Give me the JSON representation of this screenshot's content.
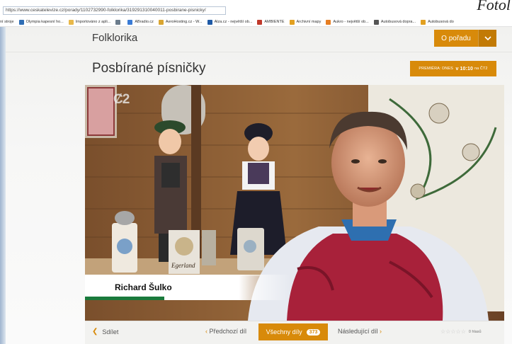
{
  "corner_text": "Fotol",
  "browser": {
    "url": "https://www.ceskatelevize.cz/porady/1102732990-folklorika/319291310040011-posbirane-pisnicky/",
    "bookmarks": [
      {
        "label": "ní stroje",
        "icon": "none",
        "color": "#ffffff"
      },
      {
        "label": "Olympia kapesní ho...",
        "icon": "doc-icon",
        "color": "#2e6db4"
      },
      {
        "label": "Importováno z apli...",
        "icon": "folder-icon",
        "color": "#e8b84a"
      },
      {
        "label": "",
        "icon": "puzzle-icon",
        "color": "#6b7c8c"
      },
      {
        "label": "ABradio.cz",
        "icon": "radio-icon",
        "color": "#3a7bd5"
      },
      {
        "label": "AeroHosting.cz - W...",
        "icon": "cloud-icon",
        "color": "#d9a531"
      },
      {
        "label": "Alza.cz - největší ob...",
        "icon": "cart-icon",
        "color": "#1f5aa6"
      },
      {
        "label": "AMBIENTE",
        "icon": "circle-icon",
        "color": "#c0392b"
      },
      {
        "label": "Archivní mapy",
        "icon": "map-icon",
        "color": "#e2a020"
      },
      {
        "label": "Aukro - největší ob...",
        "icon": "a-icon",
        "color": "#e67e22"
      },
      {
        "label": "Autobusová dopra...",
        "icon": "bus-icon",
        "color": "#555555"
      },
      {
        "label": "Autobusová do",
        "icon": "bus-icon",
        "color": "#e2a020"
      }
    ]
  },
  "header": {
    "show_name": "Folklorika",
    "about_label": "O pořadu"
  },
  "episode": {
    "title": "Posbírané písničky",
    "premiere_prefix": "PREMIÉRA: DNES",
    "premiere_time": "v 10:10",
    "premiere_channel": "na ČT2"
  },
  "video": {
    "channel_logo": "Ȼ2",
    "speaker_name": "Richard Šulko",
    "stein_label": "Egerland"
  },
  "controls": {
    "share_label": "Sdílet",
    "prev_label": "Předchozí díl",
    "all_label": "Všechny díly",
    "all_count": "373",
    "next_label": "Následující díl",
    "rating_stars": "☆☆☆☆☆",
    "rating_text": "0 hlasů"
  },
  "colors": {
    "accent": "#d88a0a",
    "stripe": "#1a7a3c"
  }
}
